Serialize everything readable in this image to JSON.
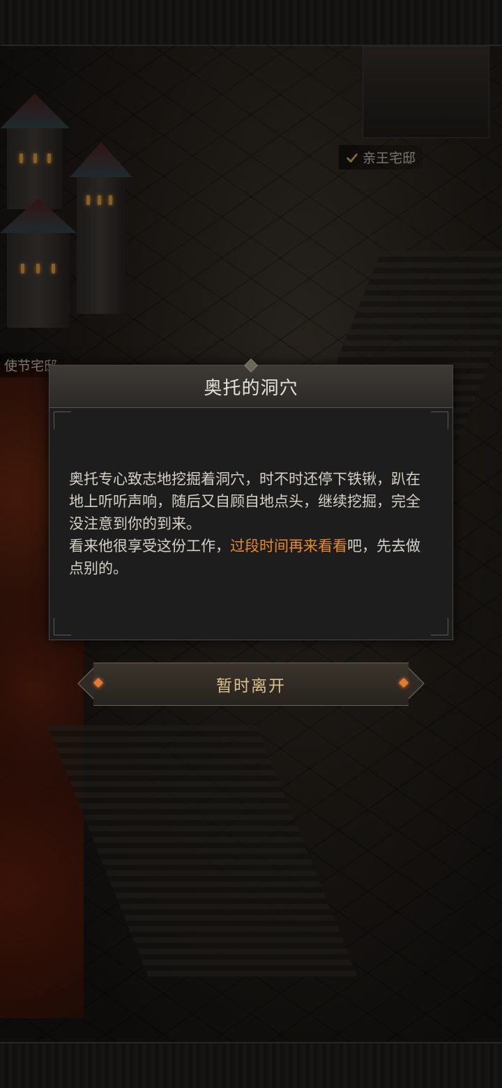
{
  "map": {
    "labels": {
      "prince_mansion": "亲王宅邸",
      "envoy_mansion": "使节宅邸"
    }
  },
  "dialog": {
    "title": "奥托的洞穴",
    "paragraph1": "奥托专心致志地挖掘着洞穴，时不时还停下铁锹，趴在地上听听声响，随后又自顾自地点头，继续挖掘，完全没注意到你的到来。",
    "paragraph2_before": "看来他很享受这份工作，",
    "paragraph2_highlight": "过段时间再来看看",
    "paragraph2_after": "吧，先去做点别的。"
  },
  "actions": {
    "leave_label": "暂时离开"
  },
  "colors": {
    "highlight": "#e8892e",
    "button_text": "#dcc28e",
    "panel_bg": "#1e1d1d"
  }
}
